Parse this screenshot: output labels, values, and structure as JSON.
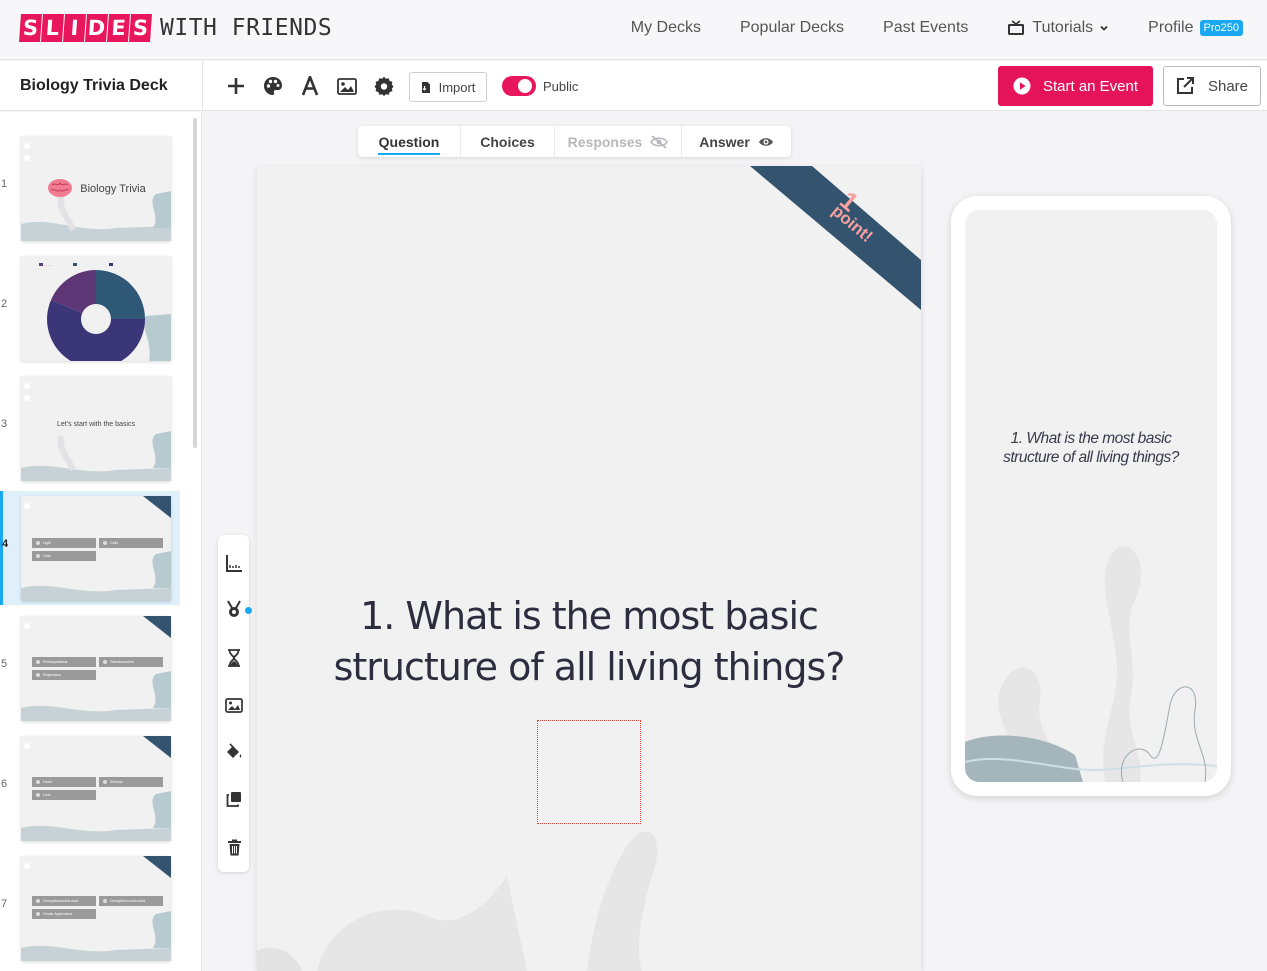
{
  "brand": {
    "logo_letters": [
      "S",
      "L",
      "I",
      "D",
      "E",
      "S"
    ],
    "logo_rest": "WITH FRIENDS",
    "accent": "#e8165c",
    "blue": "#1ba8f2",
    "navy": "#34536f"
  },
  "nav": {
    "links": [
      "My Decks",
      "Popular Decks",
      "Past Events"
    ],
    "tutorials": "Tutorials",
    "profile": "Profile",
    "pro_badge": "Pro250"
  },
  "toolbar": {
    "deck_title": "Biology Trivia Deck",
    "import_label": "Import",
    "public_label": "Public",
    "public_on": true,
    "start_event_label": "Start an Event",
    "share_label": "Share"
  },
  "sidebar": {
    "slides": [
      {
        "num": "1",
        "kind": "title",
        "title": "Biology Trivia"
      },
      {
        "num": "2",
        "kind": "chart"
      },
      {
        "num": "3",
        "kind": "text",
        "title": "Let's start with the basics"
      },
      {
        "num": "4",
        "kind": "question",
        "choices": [
          "Light",
          "Cells",
          "Cells"
        ]
      },
      {
        "num": "5",
        "kind": "question",
        "choices": [
          "Photosynthesis",
          "Transformation",
          "Respiration"
        ]
      },
      {
        "num": "6",
        "kind": "question",
        "choices": [
          "Heart",
          "Kidneys",
          "Liver"
        ]
      },
      {
        "num": "7",
        "kind": "question",
        "choices": [
          "Deoxyribonucleic Acid",
          "Deoxyribonucleic Acid",
          "Ovular Appendant"
        ]
      }
    ]
  },
  "tabs": [
    {
      "label": "Question",
      "state": "active"
    },
    {
      "label": "Choices",
      "state": "normal"
    },
    {
      "label": "Responses",
      "state": "disabled",
      "icon": "eye-slash-icon"
    },
    {
      "label": "Answer",
      "state": "normal",
      "icon": "eye-icon"
    }
  ],
  "slide": {
    "points_number": "1",
    "points_text": "point!",
    "question": "1. What is the most basic structure of all living things?"
  },
  "preview": {
    "question": "1. What is the most basic structure of all living things?"
  }
}
